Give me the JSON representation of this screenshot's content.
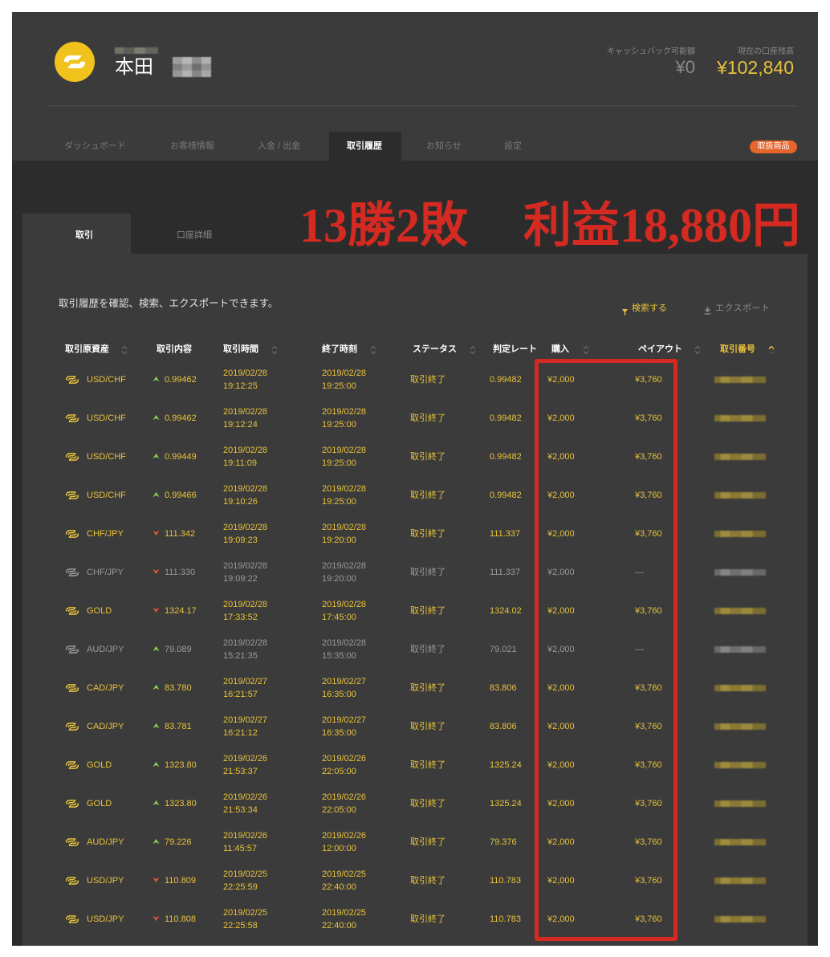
{
  "colors": {
    "accent_yellow": "#e8c23a",
    "muted_gray": "#9a9a9a",
    "up_green": "#8fd14f",
    "down_red": "#e8553a",
    "annotation_red": "#d42a22",
    "badge_orange": "#e5652b"
  },
  "header": {
    "logo_icon": "brand-logo-icon",
    "user_name": "本田",
    "cashback_label": "キャッシュバック可能額",
    "cashback_value": "¥0",
    "balance_label": "現在の口座残高",
    "balance_value": "¥102,840"
  },
  "nav": {
    "tabs": [
      {
        "label": "ダッシュボード",
        "active": false
      },
      {
        "label": "お客様情報",
        "active": false
      },
      {
        "label": "入金 / 出金",
        "active": false
      },
      {
        "label": "取引履歴",
        "active": true
      },
      {
        "label": "お知らせ",
        "active": false
      },
      {
        "label": "設定",
        "active": false
      }
    ],
    "products_badge": "取扱商品"
  },
  "subtabs": [
    {
      "label": "取引",
      "active": true
    },
    {
      "label": "口座詳細",
      "active": false
    }
  ],
  "annotation": {
    "record": "13勝2敗",
    "profit": "利益18,880円"
  },
  "history": {
    "intro_text": "取引履歴を確認、検索、エクスポートできます。",
    "search_icon": "filter-icon",
    "search_label": "検索する",
    "export_icon": "download-icon",
    "export_label": "エクスポート"
  },
  "table": {
    "columns": [
      {
        "label": "取引原資産",
        "sortable": true,
        "sort_active": false
      },
      {
        "label": "取引内容",
        "sortable": false,
        "sort_active": false
      },
      {
        "label": "取引時間",
        "sortable": true,
        "sort_active": false
      },
      {
        "label": "終了時刻",
        "sortable": true,
        "sort_active": false
      },
      {
        "label": "ステータス",
        "sortable": true,
        "sort_active": false
      },
      {
        "label": "判定レート",
        "sortable": false,
        "sort_active": false
      },
      {
        "label": "購入",
        "sortable": true,
        "sort_active": false
      },
      {
        "label": "ペイアウト",
        "sortable": true,
        "sort_active": false
      },
      {
        "label": "取引番号",
        "sortable": true,
        "sort_active": true
      }
    ],
    "rows": [
      {
        "asset": "USD/CHF",
        "direction_icon": "arrow-up-icon",
        "entry_rate": "0.99462",
        "open_date": "2019/02/28",
        "open_time": "19:12:25",
        "close_date": "2019/02/28",
        "close_time": "19:25:00",
        "status": "取引終了",
        "judge_rate": "0.99482",
        "purchase": "¥2,000",
        "payout": "¥3,760",
        "dimmed": false
      },
      {
        "asset": "USD/CHF",
        "direction_icon": "arrow-up-icon",
        "entry_rate": "0.99462",
        "open_date": "2019/02/28",
        "open_time": "19:12:24",
        "close_date": "2019/02/28",
        "close_time": "19:25:00",
        "status": "取引終了",
        "judge_rate": "0.99482",
        "purchase": "¥2,000",
        "payout": "¥3,760",
        "dimmed": false
      },
      {
        "asset": "USD/CHF",
        "direction_icon": "arrow-up-icon",
        "entry_rate": "0.99449",
        "open_date": "2019/02/28",
        "open_time": "19:11:09",
        "close_date": "2019/02/28",
        "close_time": "19:25:00",
        "status": "取引終了",
        "judge_rate": "0.99482",
        "purchase": "¥2,000",
        "payout": "¥3,760",
        "dimmed": false
      },
      {
        "asset": "USD/CHF",
        "direction_icon": "arrow-up-icon",
        "entry_rate": "0.99466",
        "open_date": "2019/02/28",
        "open_time": "19:10:26",
        "close_date": "2019/02/28",
        "close_time": "19:25:00",
        "status": "取引終了",
        "judge_rate": "0.99482",
        "purchase": "¥2,000",
        "payout": "¥3,760",
        "dimmed": false
      },
      {
        "asset": "CHF/JPY",
        "direction_icon": "arrow-down-icon",
        "entry_rate": "111.342",
        "open_date": "2019/02/28",
        "open_time": "19:09:23",
        "close_date": "2019/02/28",
        "close_time": "19:20:00",
        "status": "取引終了",
        "judge_rate": "111.337",
        "purchase": "¥2,000",
        "payout": "¥3,760",
        "dimmed": false
      },
      {
        "asset": "CHF/JPY",
        "direction_icon": "arrow-down-icon",
        "entry_rate": "111.330",
        "open_date": "2019/02/28",
        "open_time": "19:09:22",
        "close_date": "2019/02/28",
        "close_time": "19:20:00",
        "status": "取引終了",
        "judge_rate": "111.337",
        "purchase": "¥2,000",
        "payout": "—",
        "dimmed": true
      },
      {
        "asset": "GOLD",
        "direction_icon": "arrow-down-icon",
        "entry_rate": "1324.17",
        "open_date": "2019/02/28",
        "open_time": "17:33:52",
        "close_date": "2019/02/28",
        "close_time": "17:45:00",
        "status": "取引終了",
        "judge_rate": "1324.02",
        "purchase": "¥2,000",
        "payout": "¥3,760",
        "dimmed": false
      },
      {
        "asset": "AUD/JPY",
        "direction_icon": "arrow-up-icon",
        "entry_rate": "79.089",
        "open_date": "2019/02/28",
        "open_time": "15:21:35",
        "close_date": "2019/02/28",
        "close_time": "15:35:00",
        "status": "取引終了",
        "judge_rate": "79.021",
        "purchase": "¥2,000",
        "payout": "—",
        "dimmed": true
      },
      {
        "asset": "CAD/JPY",
        "direction_icon": "arrow-up-icon",
        "entry_rate": "83.780",
        "open_date": "2019/02/27",
        "open_time": "16:21:57",
        "close_date": "2019/02/27",
        "close_time": "16:35:00",
        "status": "取引終了",
        "judge_rate": "83.806",
        "purchase": "¥2,000",
        "payout": "¥3,760",
        "dimmed": false
      },
      {
        "asset": "CAD/JPY",
        "direction_icon": "arrow-up-icon",
        "entry_rate": "83.781",
        "open_date": "2019/02/27",
        "open_time": "16:21:12",
        "close_date": "2019/02/27",
        "close_time": "16:35:00",
        "status": "取引終了",
        "judge_rate": "83.806",
        "purchase": "¥2,000",
        "payout": "¥3,760",
        "dimmed": false
      },
      {
        "asset": "GOLD",
        "direction_icon": "arrow-up-icon",
        "entry_rate": "1323.80",
        "open_date": "2019/02/26",
        "open_time": "21:53:37",
        "close_date": "2019/02/26",
        "close_time": "22:05:00",
        "status": "取引終了",
        "judge_rate": "1325.24",
        "purchase": "¥2,000",
        "payout": "¥3,760",
        "dimmed": false
      },
      {
        "asset": "GOLD",
        "direction_icon": "arrow-up-icon",
        "entry_rate": "1323.80",
        "open_date": "2019/02/26",
        "open_time": "21:53:34",
        "close_date": "2019/02/26",
        "close_time": "22:05:00",
        "status": "取引終了",
        "judge_rate": "1325.24",
        "purchase": "¥2,000",
        "payout": "¥3,760",
        "dimmed": false
      },
      {
        "asset": "AUD/JPY",
        "direction_icon": "arrow-up-icon",
        "entry_rate": "79.226",
        "open_date": "2019/02/26",
        "open_time": "11:45:57",
        "close_date": "2019/02/26",
        "close_time": "12:00:00",
        "status": "取引終了",
        "judge_rate": "79.376",
        "purchase": "¥2,000",
        "payout": "¥3,760",
        "dimmed": false
      },
      {
        "asset": "USD/JPY",
        "direction_icon": "arrow-down-icon",
        "entry_rate": "110.809",
        "open_date": "2019/02/25",
        "open_time": "22:25:59",
        "close_date": "2019/02/25",
        "close_time": "22:40:00",
        "status": "取引終了",
        "judge_rate": "110.783",
        "purchase": "¥2,000",
        "payout": "¥3,760",
        "dimmed": false
      },
      {
        "asset": "USD/JPY",
        "direction_icon": "arrow-down-icon",
        "entry_rate": "110.808",
        "open_date": "2019/02/25",
        "open_time": "22:25:58",
        "close_date": "2019/02/25",
        "close_time": "22:40:00",
        "status": "取引終了",
        "judge_rate": "110.783",
        "purchase": "¥2,000",
        "payout": "¥3,760",
        "dimmed": false
      }
    ]
  }
}
